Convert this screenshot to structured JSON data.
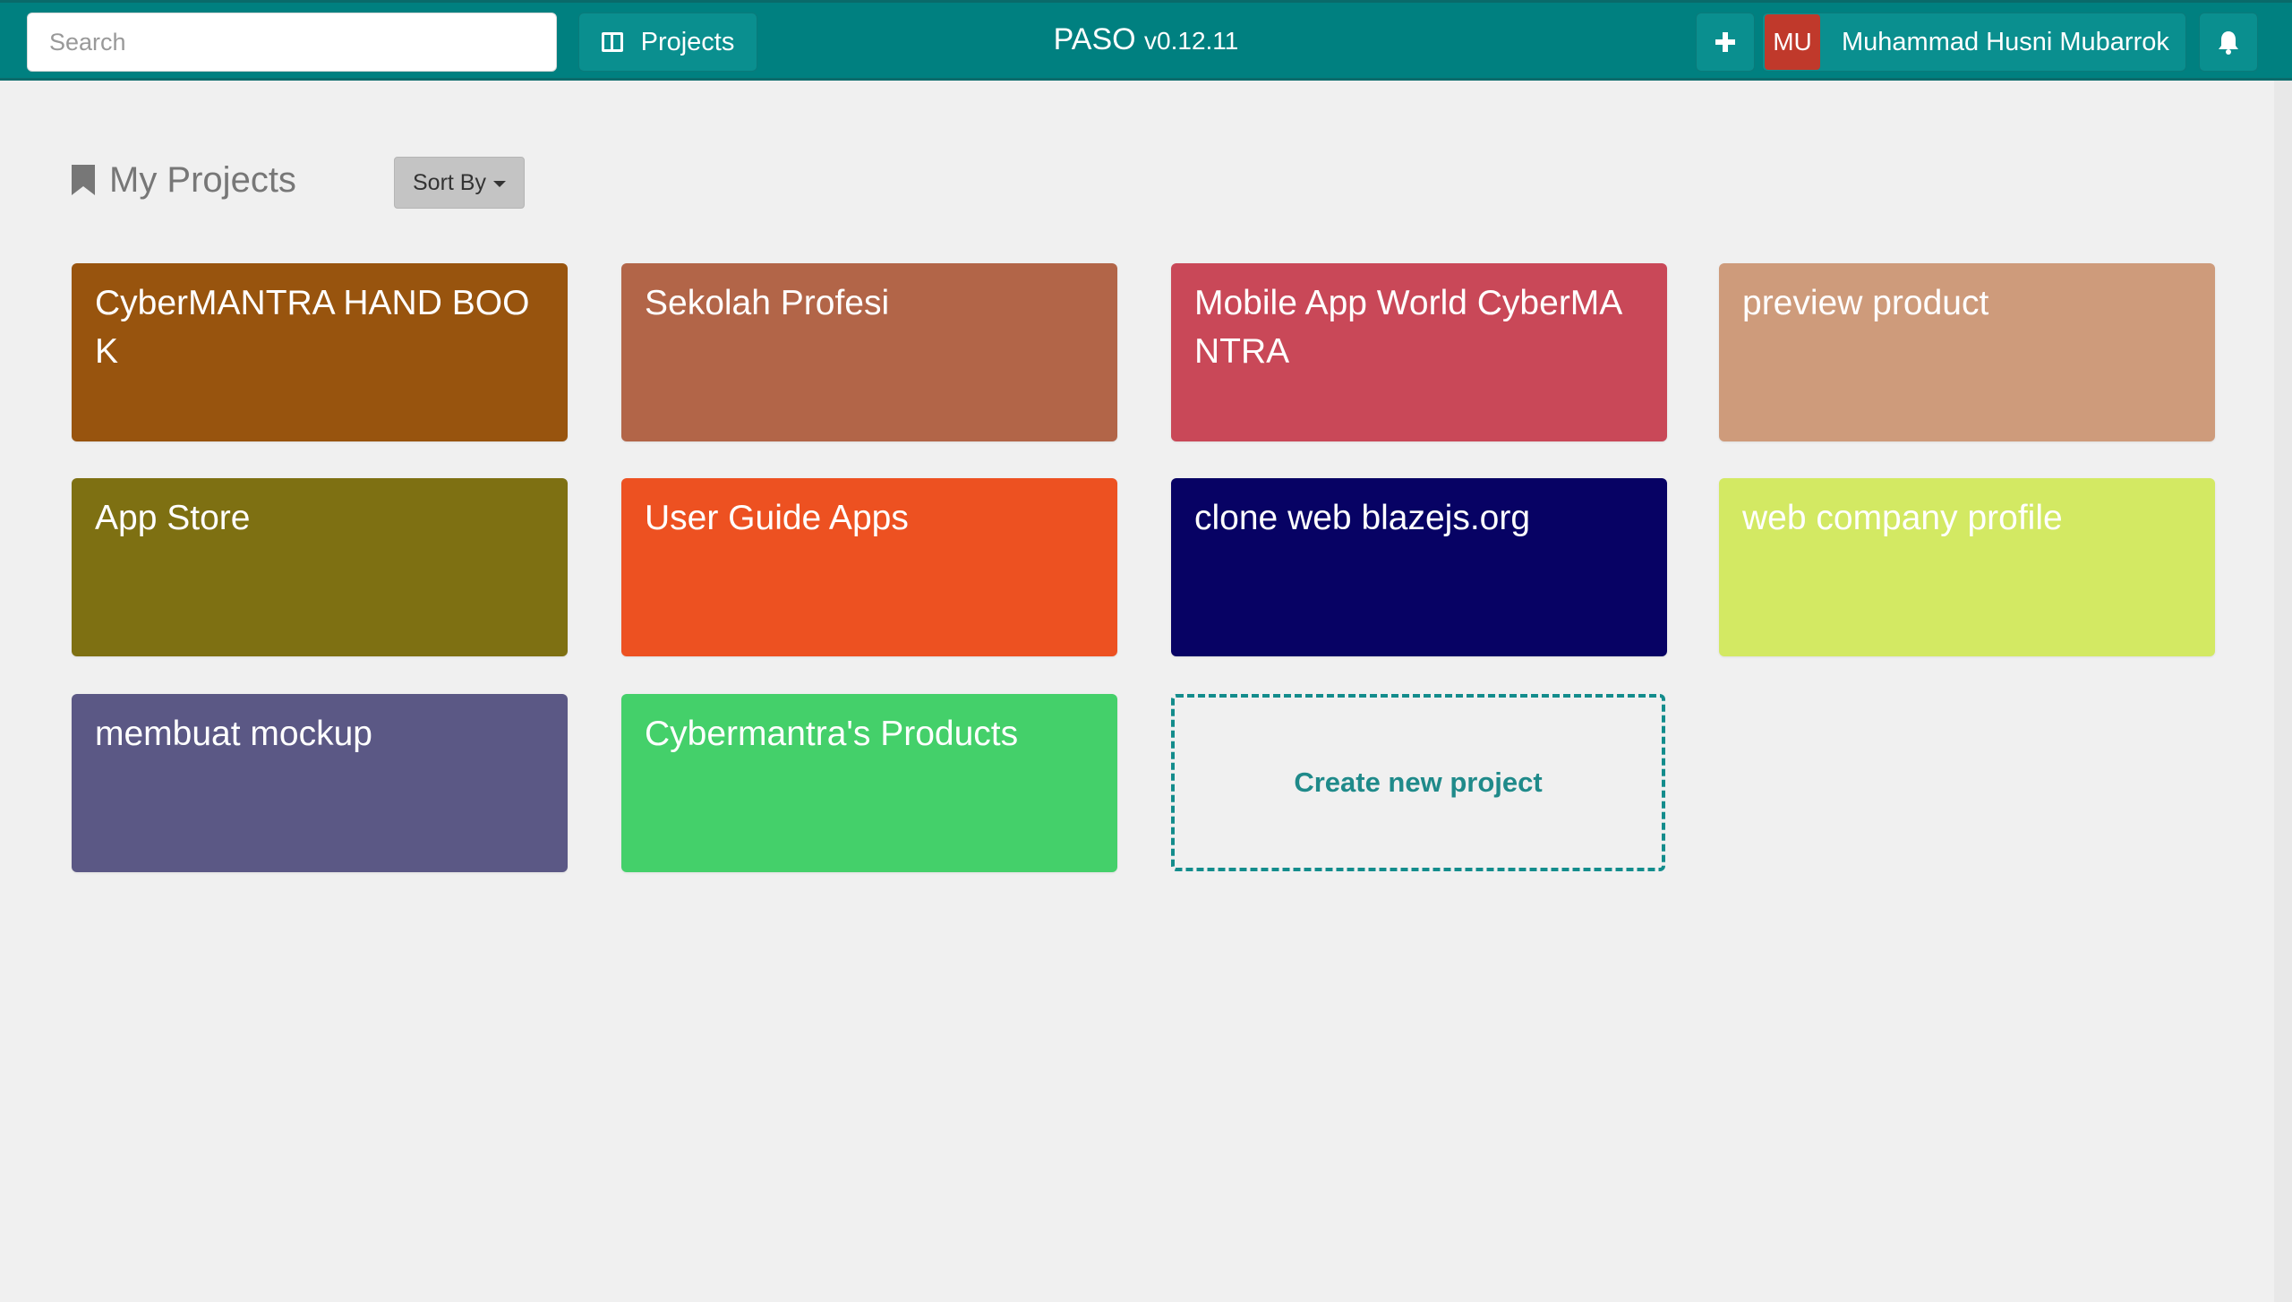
{
  "header": {
    "search_placeholder": "Search",
    "projects_label": "Projects",
    "app_name": "PASO",
    "version": "v0.12.11",
    "add_icon": "plus-icon",
    "user": {
      "initials": "MU",
      "name": "Muhammad Husni Mubarrok",
      "avatar_color": "#c0392b"
    },
    "notification_icon": "bell-icon",
    "bar_color": "#008080"
  },
  "main": {
    "section_title": "My Projects",
    "section_icon": "bookmark-icon",
    "sort_label": "Sort By",
    "projects": [
      {
        "title": "CyberMANTRA HAND BOOK",
        "color": "#98540e"
      },
      {
        "title": "Sekolah Profesi",
        "color": "#b26548"
      },
      {
        "title": "Mobile App World CyberMANTRA",
        "color": "#c94858"
      },
      {
        "title": "preview product",
        "color": "#ce9b7b"
      },
      {
        "title": "App Store",
        "color": "#7e7012"
      },
      {
        "title": "User Guide Apps",
        "color": "#ed5121"
      },
      {
        "title": "clone web blazejs.org",
        "color": "#070264"
      },
      {
        "title": "web company profile",
        "color": "#d3e963"
      },
      {
        "title": "membuat mockup",
        "color": "#5b5885"
      },
      {
        "title": "Cybermantra's Products",
        "color": "#44d06a"
      }
    ],
    "create_label": "Create new project"
  }
}
